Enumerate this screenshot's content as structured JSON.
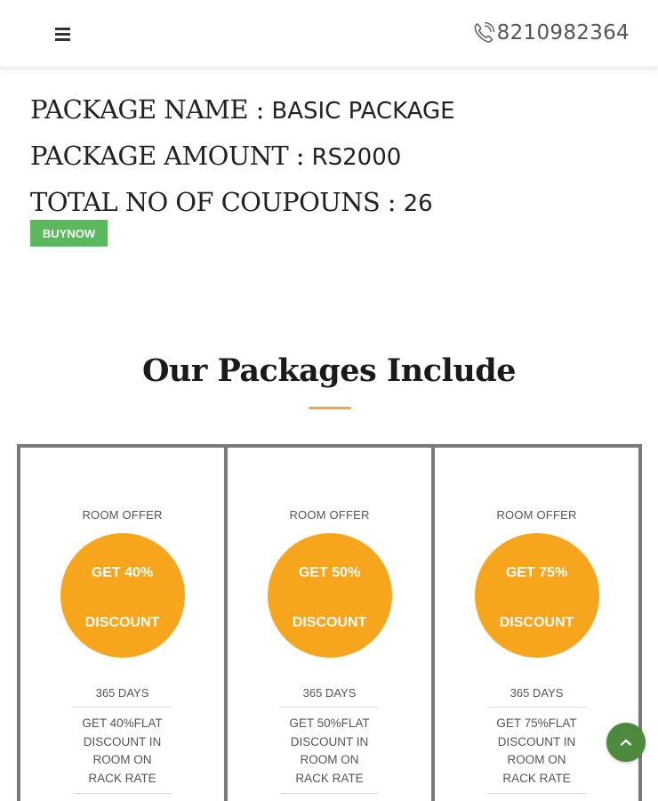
{
  "header": {
    "menu_icon": "hamburger-menu-icon",
    "phone_icon": "phone-icon",
    "phone_number": "8210982364"
  },
  "package": {
    "name_label": "PACKAGE NAME : ",
    "name_value": "BASIC PACKAGE",
    "amount_label": "PACKAGE AMOUNT : ",
    "amount_value": "RS2000",
    "coupons_label": "TOTAL NO OF COUPOUNS : ",
    "coupons_value": "26",
    "buy_label": "BUYNOW"
  },
  "section": {
    "title": "Our Packages Include"
  },
  "offers": [
    {
      "label": "ROOM OFFER",
      "circle_line1": "GET 40%",
      "circle_line2": "DISCOUNT",
      "days": "365 DAYS",
      "desc_lines": [
        "GET 40%FLAT",
        "DISCOUNT IN",
        "ROOM ON",
        "RACK RATE"
      ]
    },
    {
      "label": "ROOM OFFER",
      "circle_line1": "GET 50%",
      "circle_line2": "DISCOUNT",
      "days": "365 DAYS",
      "desc_lines": [
        "GET 50%FLAT",
        "DISCOUNT IN",
        "ROOM ON",
        "RACK RATE"
      ]
    },
    {
      "label": "ROOM OFFER",
      "circle_line1": "GET 75%",
      "circle_line2": "DISCOUNT",
      "days": "365 DAYS",
      "desc_lines": [
        "GET 75%FLAT",
        "DISCOUNT IN",
        "ROOM ON",
        "RACK RATE"
      ]
    }
  ],
  "scroll_top_icon": "chevron-up-icon",
  "colors": {
    "accent_orange": "#f7a51d",
    "buy_green": "#5cb85c",
    "scroll_green": "#4d8a3d",
    "underline": "#f2a93b"
  }
}
